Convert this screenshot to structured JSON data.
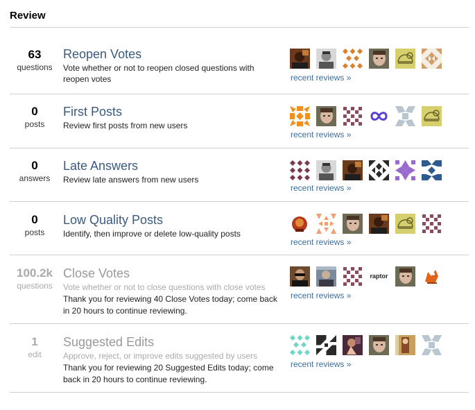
{
  "header": {
    "title": "Review"
  },
  "queues": [
    {
      "count": "63",
      "unit": "questions",
      "title": "Reopen Votes",
      "desc": "Vote whether or not to reopen closed questions with reopen votes",
      "notice": "",
      "recent": "recent reviews »"
    },
    {
      "count": "0",
      "unit": "posts",
      "title": "First Posts",
      "desc": "Review first posts from new users",
      "notice": "",
      "recent": "recent reviews »"
    },
    {
      "count": "0",
      "unit": "answers",
      "title": "Late Answers",
      "desc": "Review late answers from new users",
      "notice": "",
      "recent": "recent reviews »"
    },
    {
      "count": "0",
      "unit": "posts",
      "title": "Low Quality Posts",
      "desc": "Identify, then improve or delete low-quality posts",
      "notice": "",
      "recent": "recent reviews »"
    },
    {
      "count": "100.2k",
      "unit": "questions",
      "title": "Close Votes",
      "desc": "Vote whether or not to close questions with close votes",
      "notice": "Thank you for reviewing 40 Close Votes today; come back in 20 hours to continue reviewing.",
      "recent": "recent reviews »"
    },
    {
      "count": "1",
      "unit": "edit",
      "title": "Suggested Edits",
      "desc": "Approve, reject, or improve edits suggested by users",
      "notice": "Thank you for reviewing 20 Suggested Edits today; come back in 20 hours to continue reviewing.",
      "recent": "recent reviews »"
    }
  ],
  "avatar_labels": {
    "raptor": "raptor"
  },
  "colors": {
    "link": "#3b5a80",
    "recent_link": "#3b6ea0",
    "divider": "#cfcfcf",
    "muted": "#aaaaaa"
  }
}
